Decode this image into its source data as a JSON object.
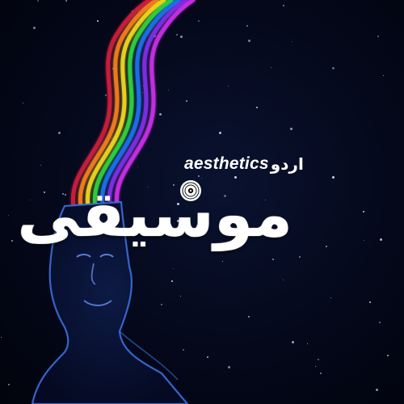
{
  "artwork": {
    "brand_latin": "aesthetics",
    "brand_urdu": "اردو",
    "title_urdu": "موسیقی",
    "rainbow_colors": [
      "#c81e3c",
      "#f07a1e",
      "#e8d21e",
      "#2ecc3c",
      "#1e6ee6",
      "#7a2ee0",
      "#c32ee0"
    ],
    "figure_color": "#3a6fe0",
    "background_color": "#04081a",
    "icons": [
      "vinyl-record-icon"
    ]
  }
}
